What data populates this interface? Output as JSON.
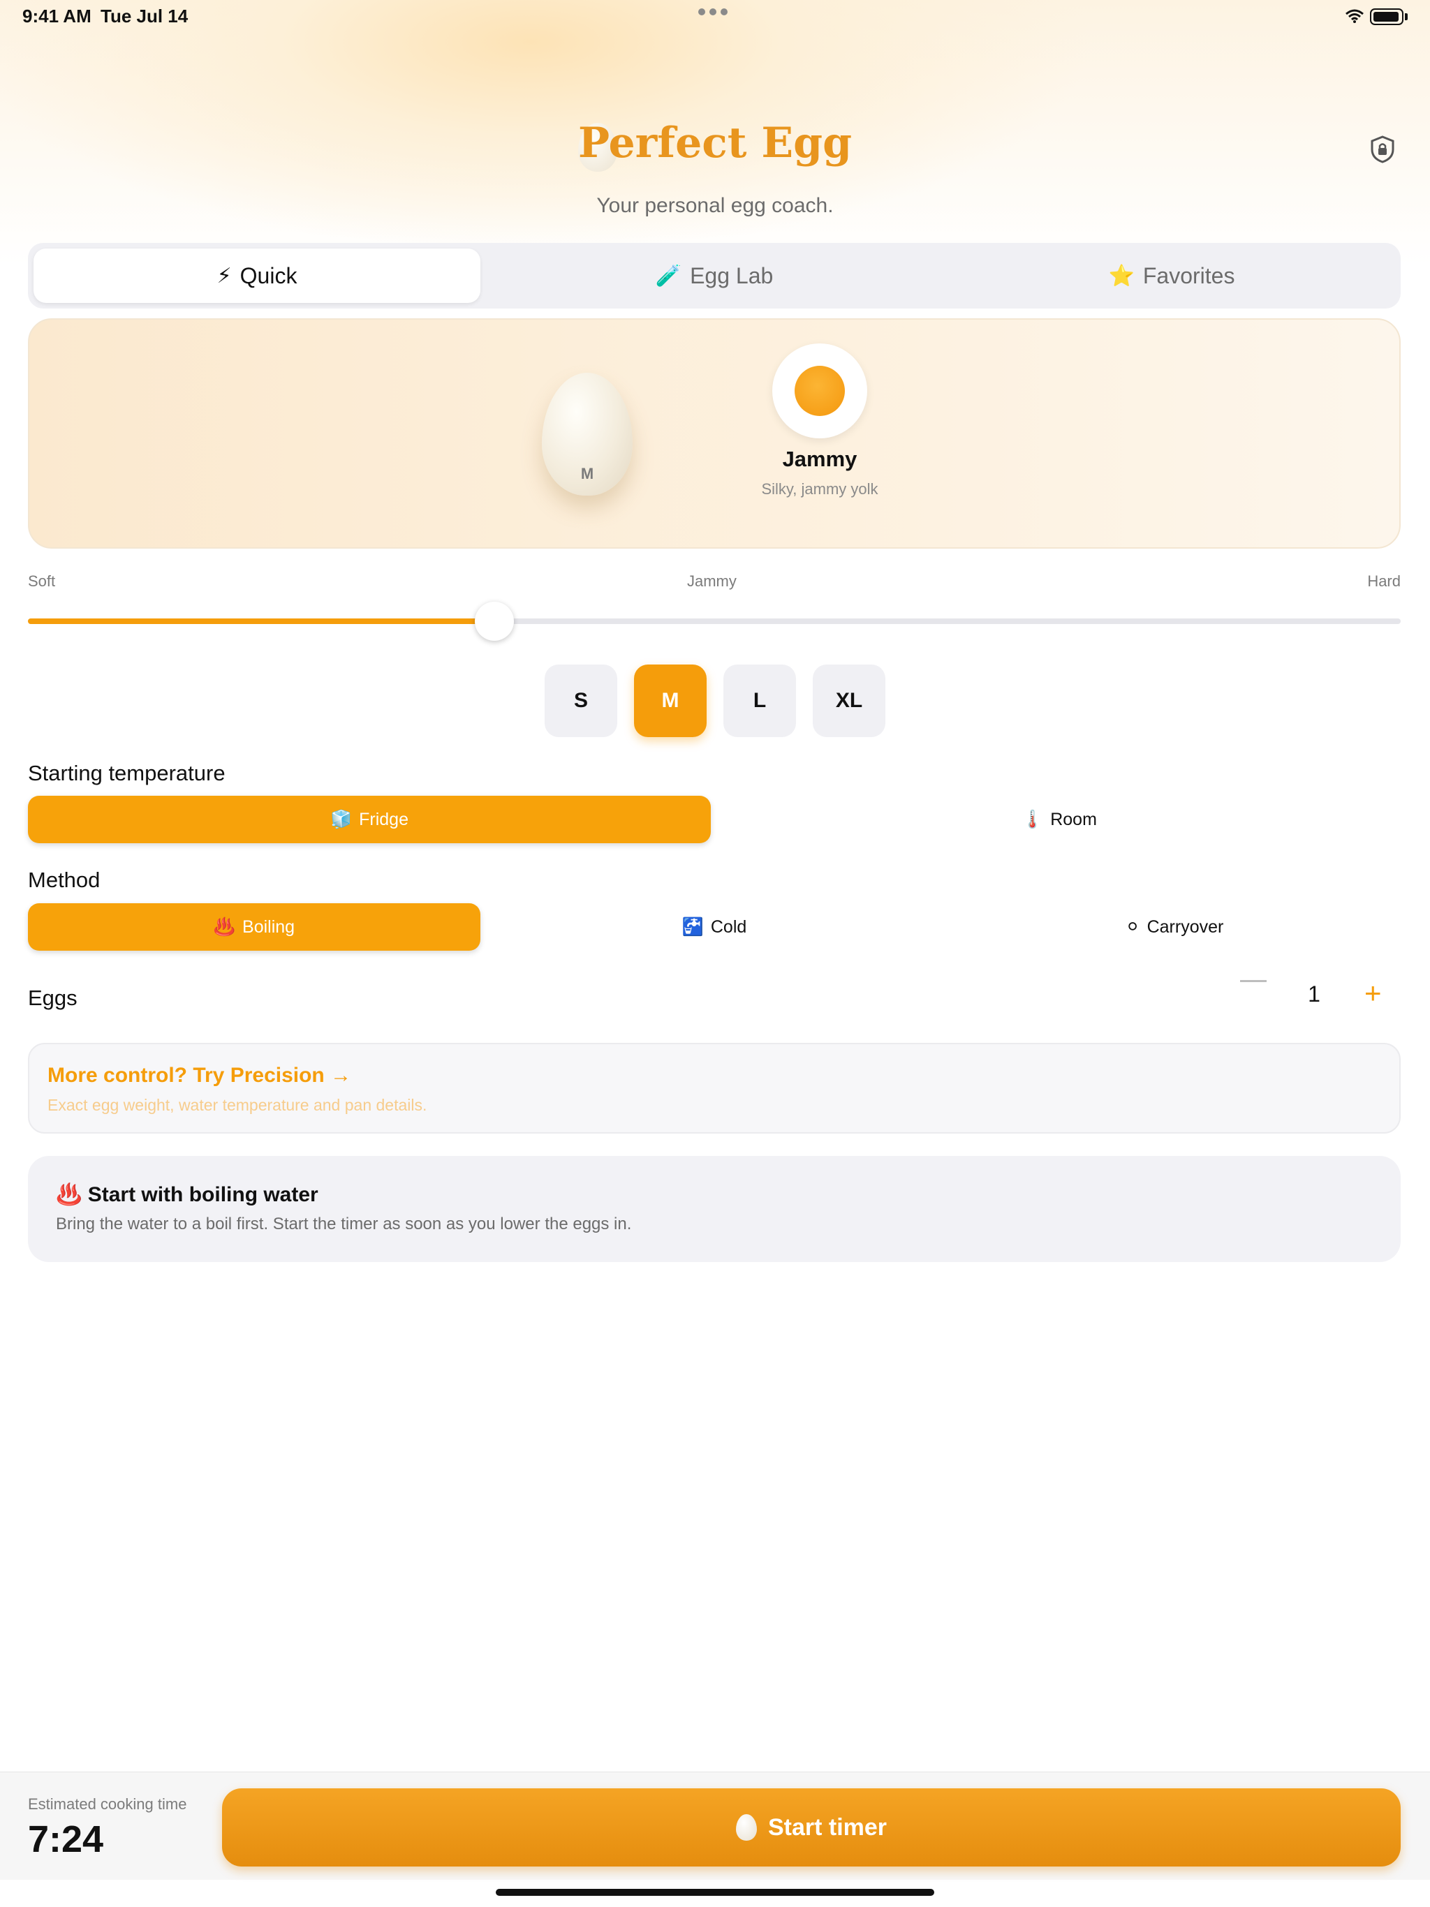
{
  "status_bar": {
    "time": "9:41 AM",
    "date": "Tue Jul 14"
  },
  "header": {
    "title": "Perfect Egg",
    "subtitle": "Your personal egg coach.",
    "lock_icon": "shield-lock-icon"
  },
  "tabs": [
    {
      "icon": "⚡",
      "label": "Quick",
      "active": true
    },
    {
      "icon": "🧪",
      "label": "Egg Lab",
      "active": false
    },
    {
      "icon": "⭐",
      "label": "Favorites",
      "active": false
    }
  ],
  "hero": {
    "egg_size": "M",
    "doneness_name": "Jammy",
    "doneness_desc": "Silky, jammy yolk"
  },
  "doneness_slider": {
    "labels": [
      "Soft",
      "Jammy",
      "Hard"
    ],
    "value_fraction": 0.34
  },
  "sizes": [
    {
      "label": "S",
      "selected": false
    },
    {
      "label": "M",
      "selected": true
    },
    {
      "label": "L",
      "selected": false
    },
    {
      "label": "XL",
      "selected": false
    }
  ],
  "starting_temperature": {
    "label": "Starting temperature",
    "options": [
      {
        "icon": "🧊",
        "label": "Fridge",
        "selected": true
      },
      {
        "icon": "🌡️",
        "label": "Room",
        "selected": false
      }
    ]
  },
  "method": {
    "label": "Method",
    "options": [
      {
        "icon": "♨️",
        "label": "Boiling",
        "selected": true
      },
      {
        "icon": "🚰",
        "label": "Cold",
        "selected": false
      },
      {
        "icon": "⚪",
        "label": "Carryover",
        "selected": false
      }
    ]
  },
  "eggs": {
    "label": "Eggs",
    "count": "1",
    "minus": "−",
    "plus": "+"
  },
  "precision_card": {
    "title": "More control? Try Precision →",
    "desc": "Exact egg weight, water temperature and pan details."
  },
  "info_card": {
    "icon": "♨️",
    "title": "Start with boiling water",
    "desc": "Bring the water to a boil first. Start the timer as soon as you lower the eggs in."
  },
  "bottom": {
    "est_label": "Estimated cooking time",
    "est_time": "7:24",
    "start_label": "Start timer"
  },
  "colors": {
    "accent": "#f59d0b",
    "title": "#e8951e"
  }
}
